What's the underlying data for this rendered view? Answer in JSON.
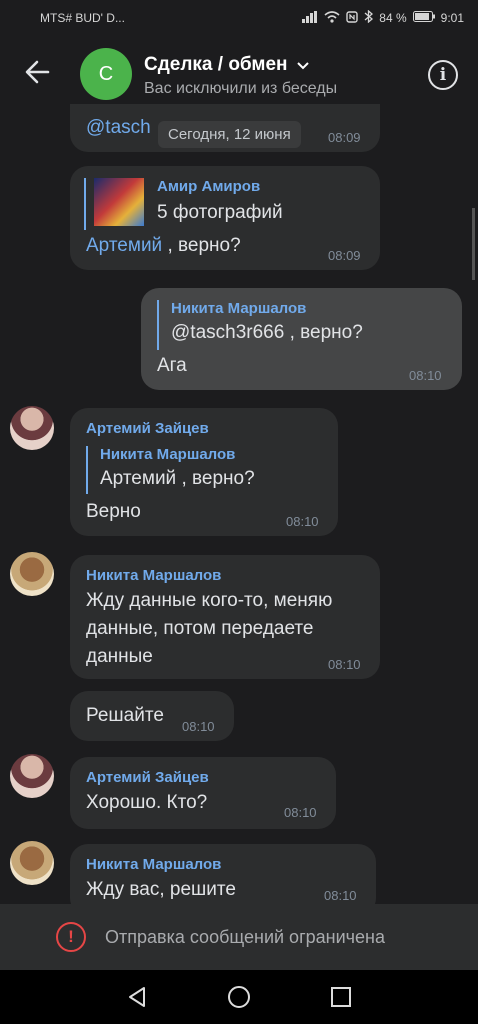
{
  "status": {
    "carrier": "MTS# BUD' D...",
    "battery": "84 %",
    "time": "9:01"
  },
  "header": {
    "avatar_letter": "С",
    "title": "Сделка / обмен",
    "subtitle": "Вас исключили из беседы"
  },
  "date_divider": "Сегодня, 12 июня",
  "messages": [
    {
      "mention": "@tasch",
      "time": "08:09"
    },
    {
      "reply_sender": "Амир Амиров",
      "reply_text": "5 фотографий",
      "mention": "Артемий",
      "text": " , верно?",
      "time": "08:09"
    },
    {
      "reply_sender": "Никита Маршалов",
      "reply_text": "@tasch3r666 , верно?",
      "text": "Ага",
      "time": "08:10"
    },
    {
      "sender": "Артемий Зайцев",
      "reply_sender": "Никита Маршалов",
      "reply_text": "Артемий , верно?",
      "text": "Верно",
      "time": "08:10"
    },
    {
      "sender": "Никита Маршалов",
      "text": "Жду данные кого-то, меняю данные, потом передаете данные",
      "time": "08:10"
    },
    {
      "text": "Решайте",
      "time": "08:10"
    },
    {
      "sender": "Артемий Зайцев",
      "text": "Хорошо. Кто?",
      "time": "08:10"
    },
    {
      "sender": "Никита Маршалов",
      "text": "Жду вас, решите",
      "time": "08:10"
    }
  ],
  "restriction_text": "Отправка сообщений ограничена",
  "colors": {
    "accent": "#71aaeb",
    "alert": "#e64646",
    "avatar": "#4bb34b"
  }
}
